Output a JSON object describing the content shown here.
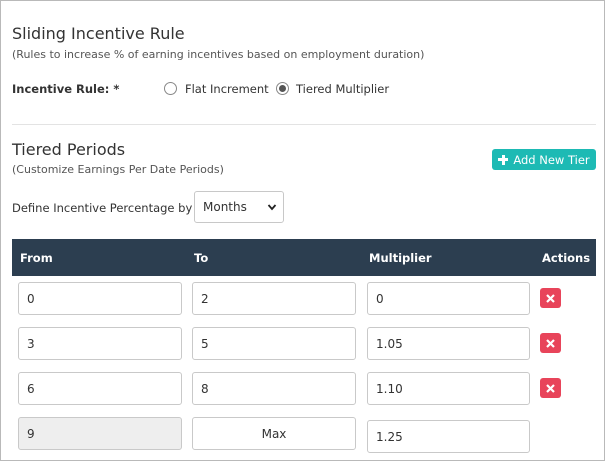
{
  "incentive": {
    "title": "Sliding Incentive Rule",
    "subtitle": "(Rules to increase % of earning incentives based on employment duration)",
    "rule_label": "Incentive Rule: *",
    "options": [
      {
        "label": "Flat Increment",
        "selected": false
      },
      {
        "label": "Tiered Multiplier",
        "selected": true
      }
    ]
  },
  "tiers": {
    "title": "Tiered Periods",
    "subtitle": "(Customize Earnings Per Date Periods)",
    "add_label": "Add New Tier",
    "define_label": "Define Incentive Percentage by",
    "period_unit": "Months",
    "columns": [
      "From",
      "To",
      "Multiplier",
      "Actions"
    ],
    "rows": [
      {
        "from": "0",
        "to": "2",
        "multiplier": "0"
      },
      {
        "from": "3",
        "to": "5",
        "multiplier": "1.05"
      },
      {
        "from": "6",
        "to": "8",
        "multiplier": "1.10"
      }
    ],
    "last_row": {
      "from": "9",
      "to": "Max",
      "multiplier": "1.25"
    }
  },
  "colors": {
    "accent": "#1dbab4",
    "header": "#2c3e50",
    "danger": "#e8445a"
  }
}
